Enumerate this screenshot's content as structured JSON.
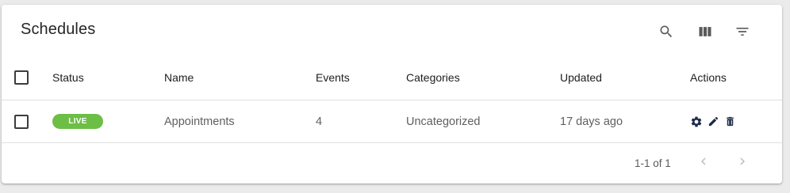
{
  "header": {
    "title": "Schedules",
    "toolbar": [
      {
        "icon": "search-icon"
      },
      {
        "icon": "view-columns-icon"
      },
      {
        "icon": "filter-list-icon"
      }
    ]
  },
  "table": {
    "columns": [
      "Status",
      "Name",
      "Events",
      "Categories",
      "Updated",
      "Actions"
    ],
    "rows": [
      {
        "status": "LIVE",
        "name": "Appointments",
        "events": "4",
        "categories": "Uncategorized",
        "updated": "17 days ago",
        "actions": [
          "settings-icon",
          "edit-icon",
          "delete-icon"
        ]
      }
    ]
  },
  "footer": {
    "pagination": "1-1 of 1"
  },
  "colors": {
    "live_badge": "#6cbe45",
    "action_icon": "#1e2a4a",
    "toolbar_icon": "#5a5a5a"
  }
}
